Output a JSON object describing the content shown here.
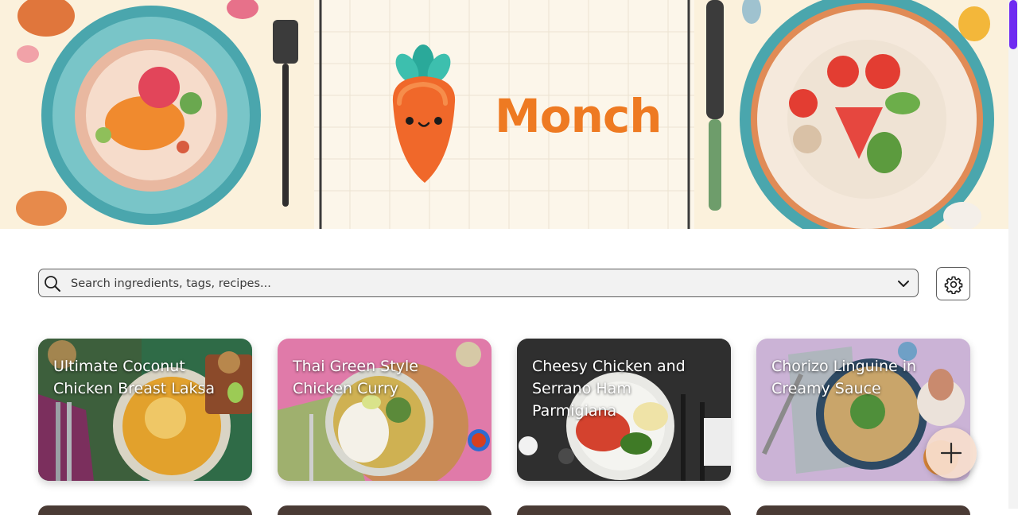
{
  "app": {
    "name": "Monch"
  },
  "search": {
    "placeholder": "Search ingredients, tags, recipes..."
  },
  "recipes": [
    {
      "title": "Ultimate Coconut Chicken Breast Laksa"
    },
    {
      "title": "Thai Green Style Chicken Curry"
    },
    {
      "title": "Cheesy Chicken and Serrano Ham Parmigiana"
    },
    {
      "title": "Chorizo Linguine in Creamy Sauce"
    }
  ],
  "icons": {
    "search": "search-icon",
    "dropdown": "chevron-down-icon",
    "settings": "gear-icon",
    "add": "plus-icon",
    "logo": "carrot-mascot-icon"
  },
  "colors": {
    "brand": "#ee7a22",
    "scrollbar": "#6f2bf1"
  }
}
